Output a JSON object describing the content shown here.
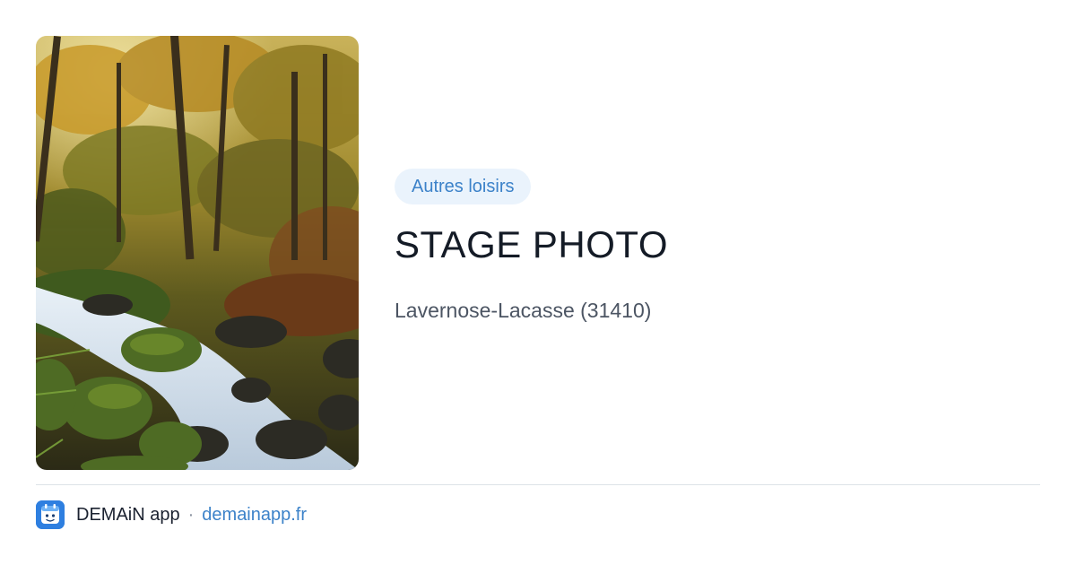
{
  "card": {
    "image": {
      "subject": "forest-stream-photo"
    },
    "category_tag": "Autres loisirs",
    "title": "STAGE PHOTO",
    "location": "Lavernose-Lacasse (31410)"
  },
  "footer": {
    "app_logo_icon": "demain-app-logo-icon",
    "app_name": "DEMAiN app",
    "separator": "·",
    "site": "demainapp.fr"
  },
  "colors": {
    "tag_background": "#eaf3fc",
    "tag_text": "#3c82c9",
    "title": "#141b26",
    "location": "#4c5563",
    "link": "#3c82c9",
    "logo": "#2e7fe0"
  }
}
